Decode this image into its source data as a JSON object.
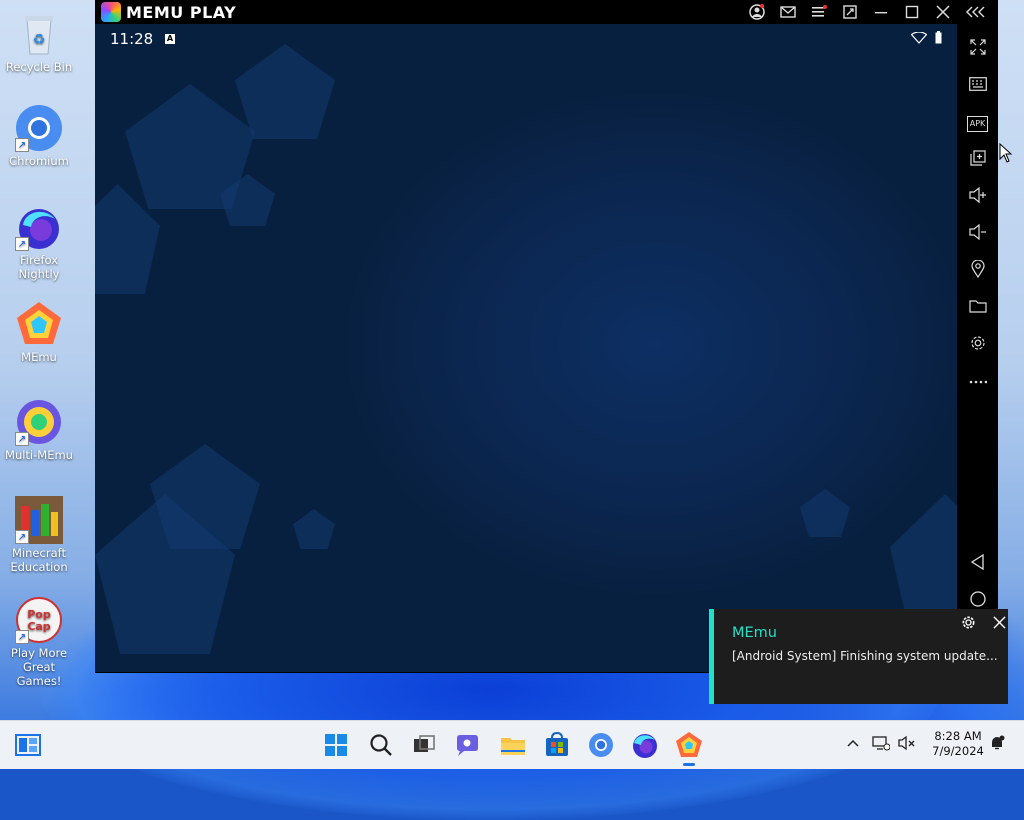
{
  "desktop": {
    "icons": [
      {
        "label": "Recycle Bin"
      },
      {
        "label": "Chromium"
      },
      {
        "label": "Firefox Nightly"
      },
      {
        "label": "MEmu"
      },
      {
        "label": "Multi-MEmu"
      },
      {
        "label": "Minecraft Education"
      },
      {
        "label": "Play More Great Games!"
      }
    ]
  },
  "emulator": {
    "title": "MEMU PLAY",
    "android_time": "11:28",
    "sidebar_tools": [
      "fullscreen-icon",
      "keyboard-icon",
      "apk-icon",
      "multi-window-icon",
      "volume-up-icon",
      "volume-down-icon",
      "location-icon",
      "folder-icon",
      "settings-icon",
      "more-icon",
      "back-icon",
      "home-icon"
    ],
    "apk_label": "APK"
  },
  "notification": {
    "app": "MEmu",
    "message": "[Android System] Finishing system update..."
  },
  "taskbar": {
    "time": "8:28 AM",
    "date": "7/9/2024"
  },
  "colors": {
    "accent": "#1fe3c8",
    "android_bg": "#0c2a55"
  }
}
